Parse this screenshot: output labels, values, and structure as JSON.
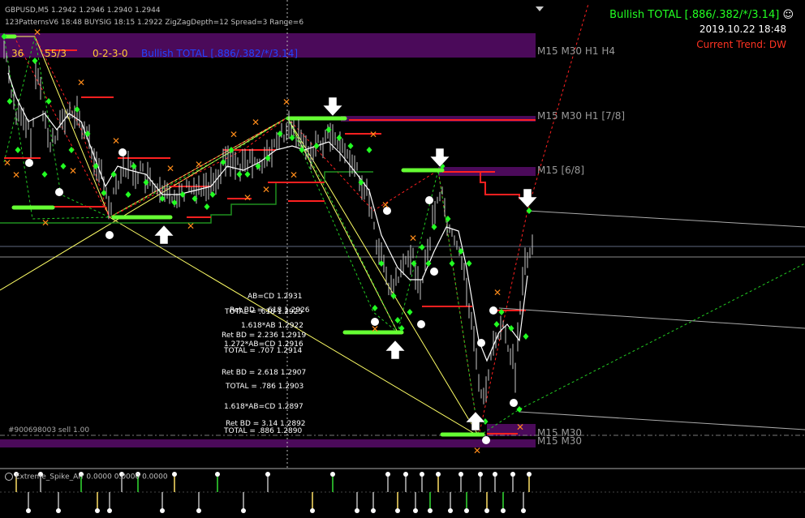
{
  "chart": {
    "symbol_line": "GBPUSD,M5  1.2942 1.2946 1.2940 1.2944",
    "indicator_line": "123PatternsV6  18:48  BUYSIG  18:15  1.2922  ZigZagDepth=12  Spread=3  Range=6",
    "top_left_numbers": {
      "a": "36",
      "b": "55/3",
      "c": "0-2-3-0"
    },
    "bullish_banner_left": "Bullish TOTAL [.886/.382/*/3.14]",
    "bullish_banner_right": "Bullish TOTAL [.886/.382/*/3.14]",
    "smiley": "☺",
    "datetime": "2019.10.22 18:48",
    "trend": "Current Trend: DW",
    "order_label": "#900698003 sell 1.00",
    "zones": [
      {
        "label": "M15 M30 H1 H4"
      },
      {
        "label": "M15 M30 H1 [7/8]"
      },
      {
        "label": "M15 [6/8]"
      },
      {
        "label": "M15 M30"
      },
      {
        "label": "M15 M30"
      }
    ],
    "fib_labels": [
      "AB=CD  1.2931",
      "Ret BD = .618  1.2926",
      "TOTAL = .618  1.2925",
      "1.618*AB  1.2922",
      "Ret BD = 2.236  1.2919",
      "1.272*AB=CD  1.2916",
      "TOTAL = .707  1.2914",
      "Ret BD = 2.618  1.2907",
      "TOTAL = .786  1.2903",
      "1.618*AB=CD  1.2897",
      "Ret BD = 3.14  1.2892",
      "TOTAL = .886  1.2890"
    ],
    "colors": {
      "background": "#000000",
      "zone_purple": "#4b0a5a",
      "bull_green": "#00ff00",
      "bear_red": "#ff2020",
      "x_orange": "#ff8c1a",
      "zigzag_yellow": "#ffff66",
      "candle": "#c8c8c8"
    }
  },
  "subwindow": {
    "label": "Extreme_Spike_Arr 0.0000  0.0000  0.0000"
  }
}
